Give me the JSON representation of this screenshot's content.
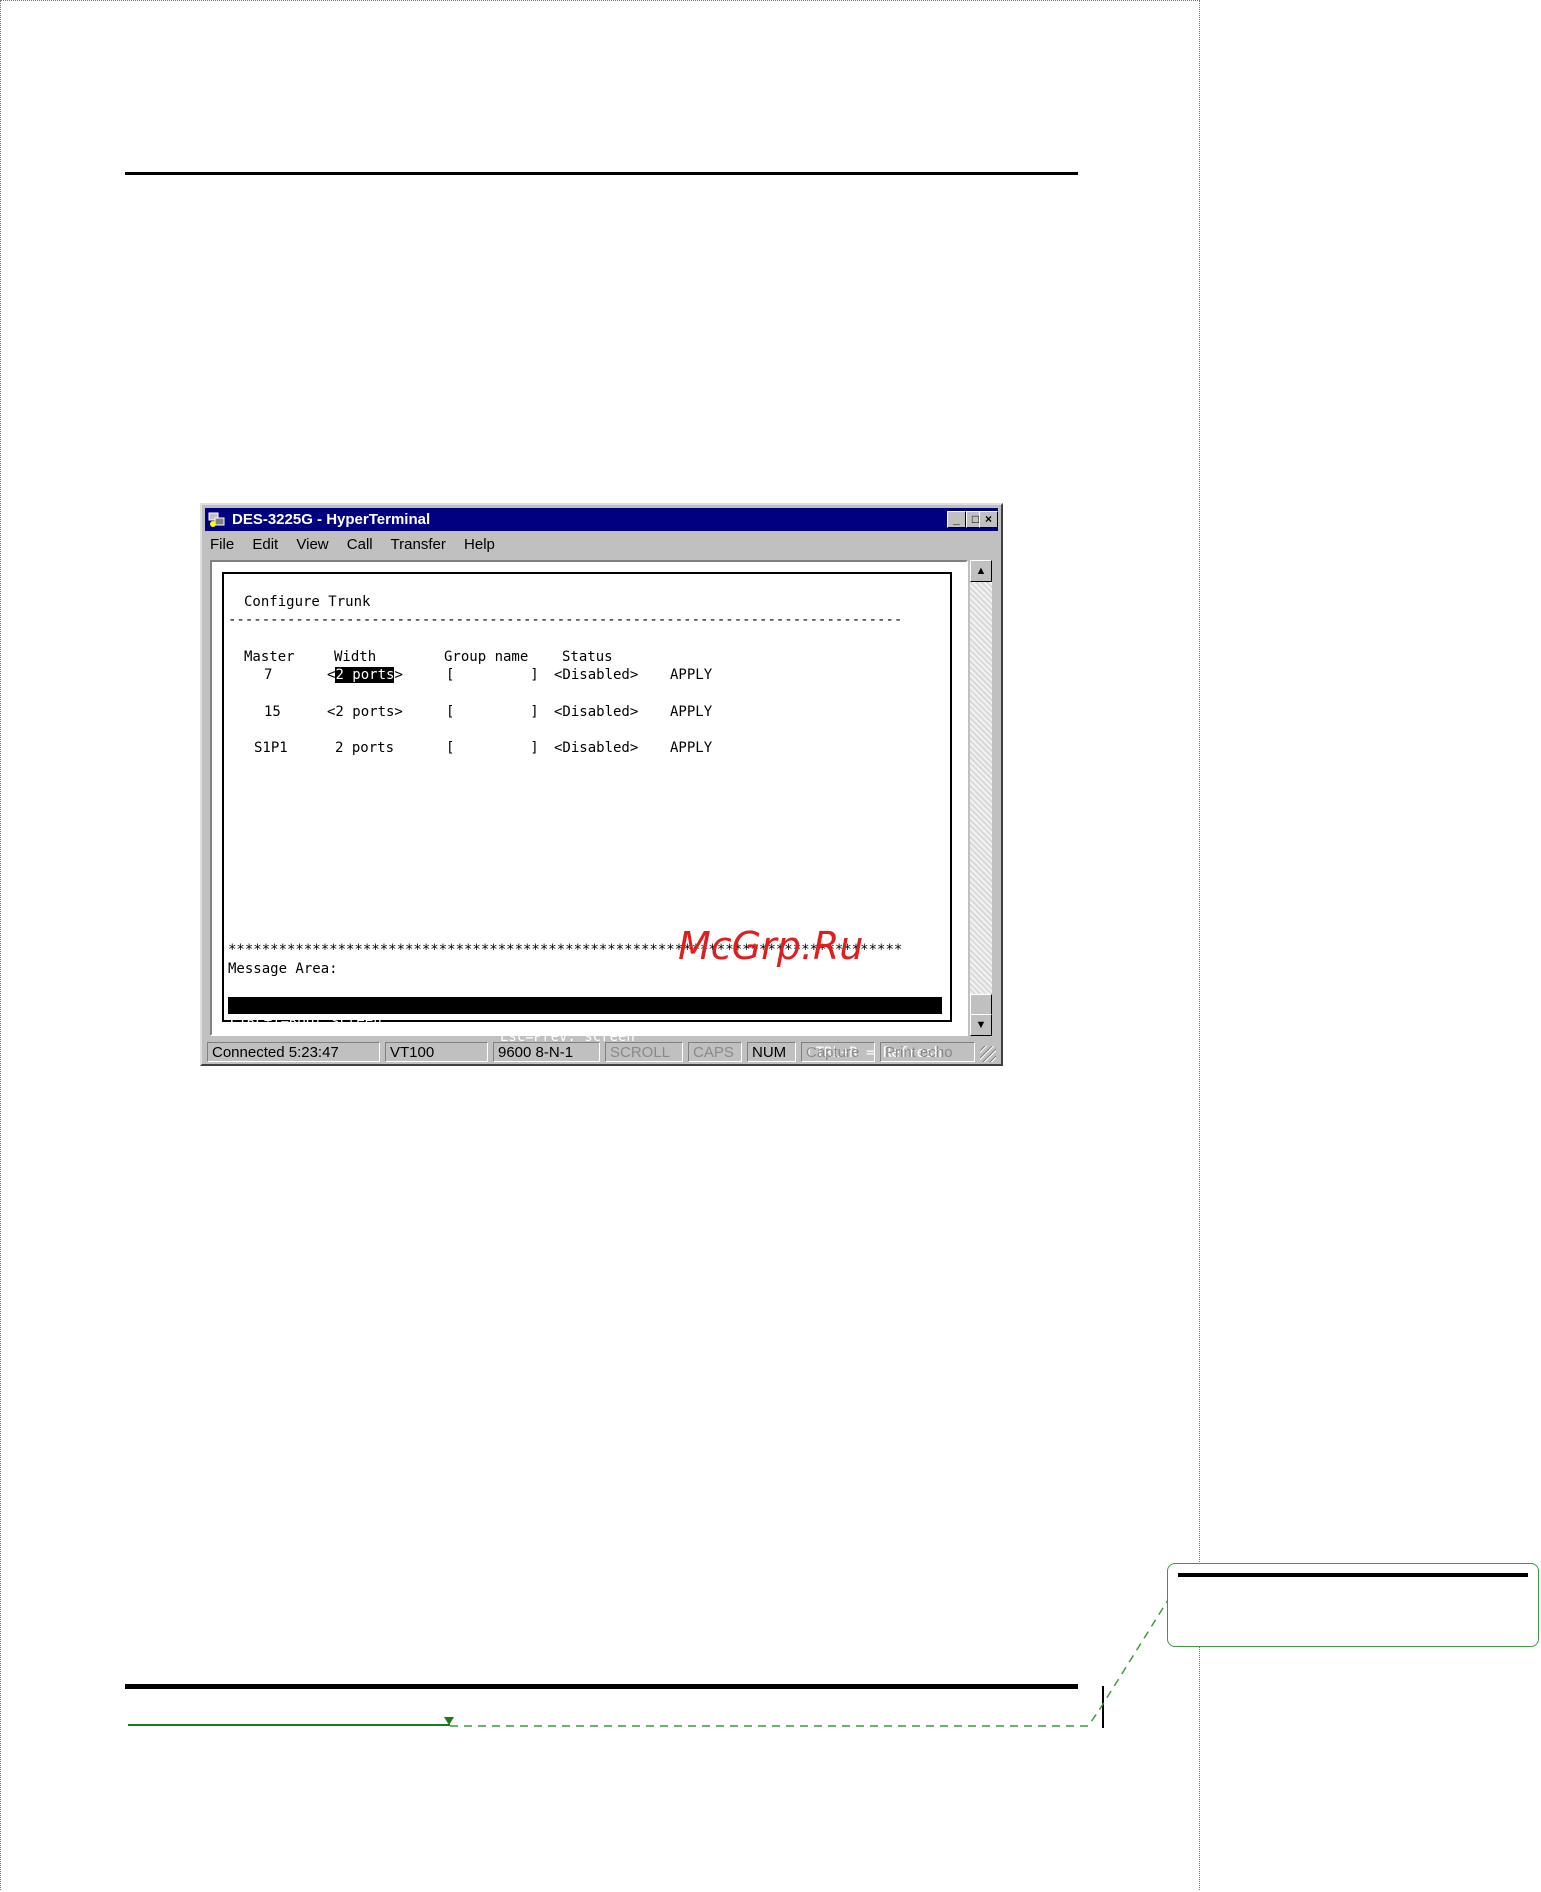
{
  "window": {
    "title": "DES-3225G - HyperTerminal",
    "controls": {
      "minimize": "_",
      "maximize": "□",
      "close": "×"
    }
  },
  "menu": [
    "File",
    "Edit",
    "View",
    "Call",
    "Transfer",
    "Help"
  ],
  "terminal": {
    "screen_title": "Configure Trunk",
    "separator": "--------------------------------------------------------------------------------",
    "headers": {
      "master": "Master",
      "width": "Width",
      "group_name": "Group name",
      "status": "Status"
    },
    "rows": [
      {
        "master": "7",
        "width": "2 ports",
        "width_open": "<",
        "width_close": ">",
        "group": "[         ]",
        "status": "<Disabled>",
        "action": "APPLY",
        "selected": true
      },
      {
        "master": "15",
        "width": "<2 ports>",
        "group": "[         ]",
        "status": "<Disabled>",
        "action": "APPLY"
      },
      {
        "master": "S1P1",
        "width": "2 ports",
        "group": "[         ]",
        "status": "<Disabled>",
        "action": "APPLY"
      }
    ],
    "stars": "********************************************************************************",
    "message_label": "Message Area:",
    "footer": {
      "left": "CTRL+T=Root screen",
      "middle": "Esc=Prev. screen",
      "right": "CTRL+R = Refresh"
    }
  },
  "statusbar": {
    "connected": "Connected 5:23:47",
    "emulation": "VT100",
    "settings": "9600 8-N-1",
    "scroll": "SCROLL",
    "caps": "CAPS",
    "num": "NUM",
    "capture": "Capture",
    "print_echo": "Print echo"
  },
  "watermark": "McGrp.Ru",
  "colors": {
    "titlebar": "#000080",
    "window": "#c0c0c0",
    "accent_green": "#1b7a1b",
    "watermark": "#dd1f1f"
  }
}
